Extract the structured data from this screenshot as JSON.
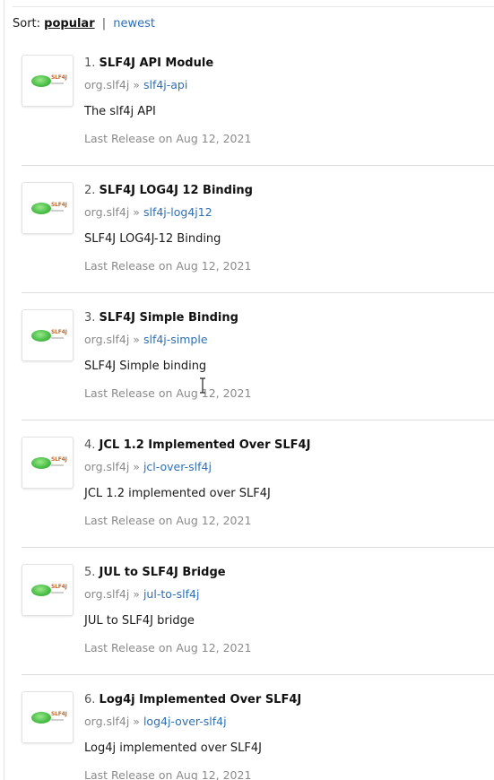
{
  "sort": {
    "label": "Sort:",
    "active": "popular",
    "separator": "|",
    "alternative": "newest"
  },
  "results": [
    {
      "number": "1.",
      "title": "SLF4J API Module",
      "group": "org.slf4j",
      "arrow": "»",
      "artifact": "slf4j-api",
      "description": "The slf4j API",
      "release": "Last Release on Aug 12, 2021",
      "logo_text": "SLF4J"
    },
    {
      "number": "2.",
      "title": "SLF4J LOG4J 12 Binding",
      "group": "org.slf4j",
      "arrow": "»",
      "artifact": "slf4j-log4j12",
      "description": "SLF4J LOG4J-12 Binding",
      "release": "Last Release on Aug 12, 2021",
      "logo_text": "SLF4J"
    },
    {
      "number": "3.",
      "title": "SLF4J Simple Binding",
      "group": "org.slf4j",
      "arrow": "»",
      "artifact": "slf4j-simple",
      "description": "SLF4J Simple binding",
      "release": "Last Release on Aug 12, 2021",
      "logo_text": "SLF4J"
    },
    {
      "number": "4.",
      "title": "JCL 1.2 Implemented Over SLF4J",
      "group": "org.slf4j",
      "arrow": "»",
      "artifact": "jcl-over-slf4j",
      "description": "JCL 1.2 implemented over SLF4J",
      "release": "Last Release on Aug 12, 2021",
      "logo_text": "SLF4J"
    },
    {
      "number": "5.",
      "title": "JUL to SLF4J Bridge",
      "group": "org.slf4j",
      "arrow": "»",
      "artifact": "jul-to-slf4j",
      "description": "JUL to SLF4J bridge",
      "release": "Last Release on Aug 12, 2021",
      "logo_text": "SLF4J"
    },
    {
      "number": "6.",
      "title": "Log4j Implemented Over SLF4J",
      "group": "org.slf4j",
      "arrow": "»",
      "artifact": "log4j-over-slf4j",
      "description": "Log4j implemented over SLF4J",
      "release": "Last Release on Aug 12, 2021",
      "logo_text": "SLF4J"
    }
  ],
  "colors": {
    "link": "#2f6fb6",
    "muted": "#8a8a8a",
    "logo_green": "#4cc04a"
  },
  "icons": {
    "result_logo": "slf4j-logo-icon",
    "mouse_cursor": "text-cursor-icon"
  }
}
